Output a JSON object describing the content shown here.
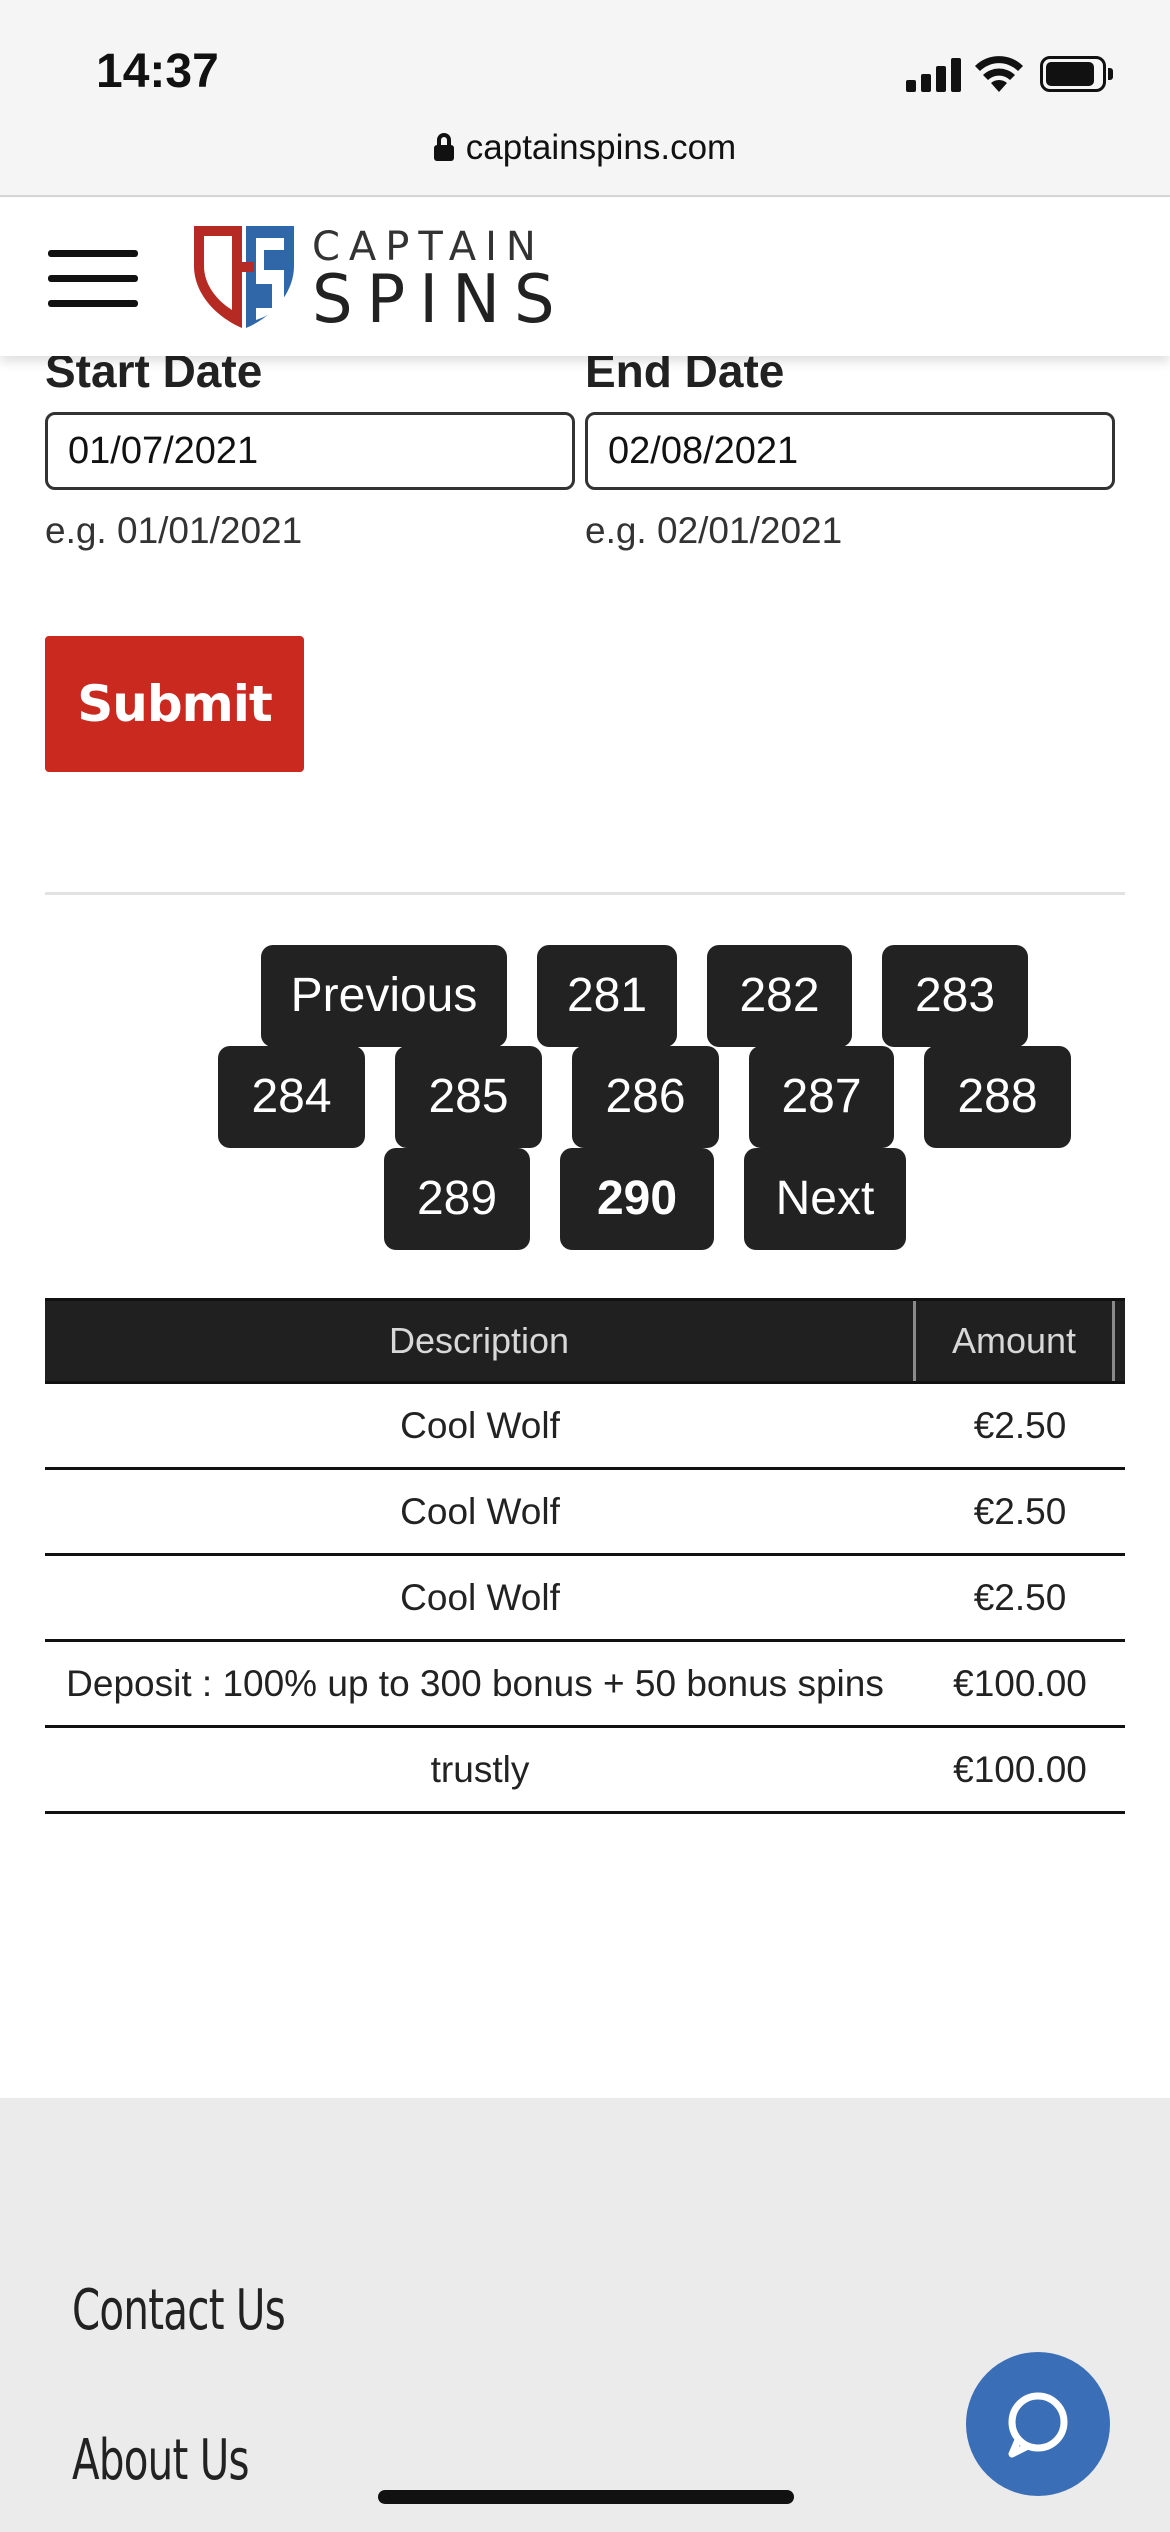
{
  "status_bar": {
    "time": "14:37",
    "url": "captainspins.com"
  },
  "header": {
    "logo_line1": "CAPTAIN",
    "logo_line2": "SPINS"
  },
  "form": {
    "start_label": "Start Date",
    "start_value": "01/07/2021",
    "start_hint": "e.g. 01/01/2021",
    "end_label": "End Date",
    "end_value": "02/08/2021",
    "end_hint": "e.g. 02/01/2021",
    "submit_label": "Submit"
  },
  "pagination": {
    "previous": "Previous",
    "pages": [
      "281",
      "282",
      "283",
      "284",
      "285",
      "286",
      "287",
      "288",
      "289",
      "290"
    ],
    "current": "290",
    "next": "Next"
  },
  "table": {
    "headers": {
      "description": "Description",
      "amount": "Amount"
    },
    "rows": [
      {
        "description": "Cool Wolf",
        "amount": "€2.50"
      },
      {
        "description": "Cool Wolf",
        "amount": "€2.50"
      },
      {
        "description": "Cool Wolf",
        "amount": "€2.50"
      },
      {
        "description": "Deposit : 100% up to 300 bonus + 50 bonus spins",
        "amount": "€100.00"
      },
      {
        "description": "trustly",
        "amount": "€100.00"
      }
    ]
  },
  "footer": {
    "links": [
      "Contact Us",
      "About Us"
    ]
  },
  "icons": {
    "lock": "lock-icon",
    "menu": "hamburger-menu-icon",
    "chat": "chat-bubble-icon",
    "signal": "cellular-signal-icon",
    "wifi": "wifi-icon",
    "battery": "battery-icon"
  },
  "colors": {
    "brand_red": "#c9291f",
    "brand_blue": "#3a6fb7",
    "page_button": "#222222"
  }
}
